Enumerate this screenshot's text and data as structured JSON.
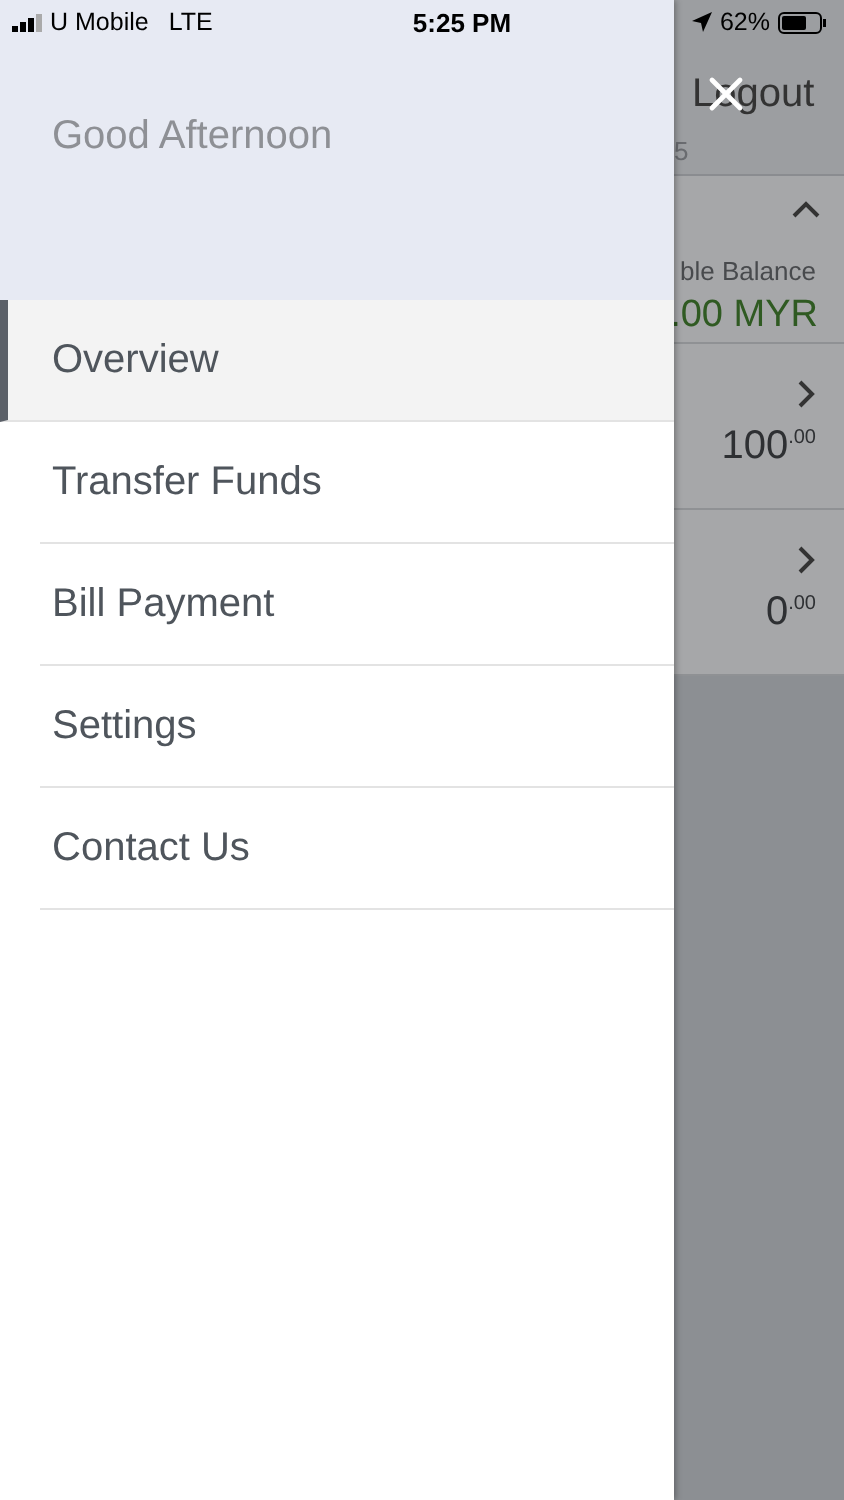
{
  "status_bar": {
    "carrier": "U Mobile",
    "network": "LTE",
    "time": "5:25 PM",
    "battery": "62%"
  },
  "drawer": {
    "greeting": "Good Afternoon",
    "items": [
      {
        "label": "Overview",
        "selected": true
      },
      {
        "label": "Transfer Funds",
        "selected": false
      },
      {
        "label": "Bill Payment",
        "selected": false
      },
      {
        "label": "Settings",
        "selected": false
      },
      {
        "label": "Contact Us",
        "selected": false
      }
    ]
  },
  "background": {
    "logout": "Logout",
    "subtitle": "5",
    "balance_label": "ble Balance",
    "balance": ".00 MYR",
    "accounts": [
      {
        "amount": "100$^{.00}$"
      },
      {
        "amount": "0$^{.00}$"
      }
    ]
  }
}
